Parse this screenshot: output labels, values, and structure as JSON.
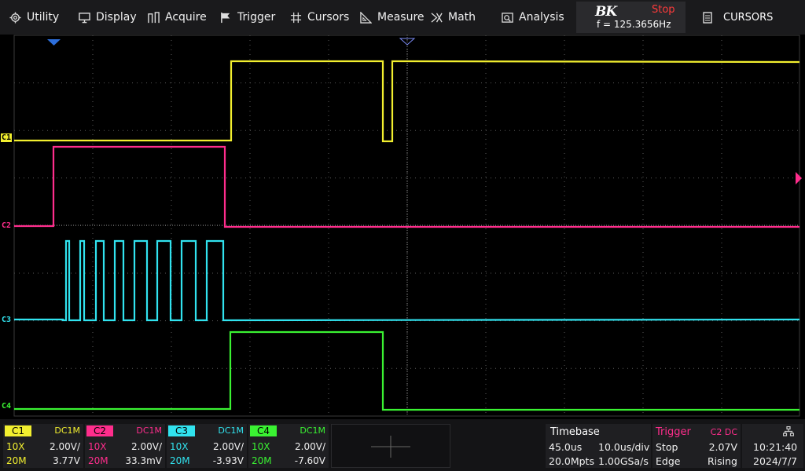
{
  "menu": {
    "items": [
      {
        "label": "Utility",
        "icon": "gear-icon"
      },
      {
        "label": "Display",
        "icon": "monitor-icon"
      },
      {
        "label": "Acquire",
        "icon": "acquire-icon"
      },
      {
        "label": "Trigger",
        "icon": "flag-icon"
      },
      {
        "label": "Cursors",
        "icon": "crosshair-icon"
      },
      {
        "label": "Measure",
        "icon": "ruler-icon"
      },
      {
        "label": "Math",
        "icon": "math-icon"
      },
      {
        "label": "Analysis",
        "icon": "analysis-icon"
      }
    ]
  },
  "brand": {
    "logo": "BK",
    "status": "Stop",
    "frequency": "f = 125.3656Hz"
  },
  "cursors_button": {
    "label": "CURSORS",
    "icon": "document-icon"
  },
  "channels": [
    {
      "id": "C1",
      "color": "#f2ef2f",
      "coupling": "DC1M",
      "probe": "10X",
      "scale": "2.00V/",
      "bandwidth": "20M",
      "offset": "3.77V"
    },
    {
      "id": "C2",
      "color": "#ff2d8c",
      "coupling": "DC1M",
      "probe": "10X",
      "scale": "2.00V/",
      "bandwidth": "20M",
      "offset": "33.3mV"
    },
    {
      "id": "C3",
      "color": "#31e3ef",
      "coupling": "DC1M",
      "probe": "10X",
      "scale": "2.00V/",
      "bandwidth": "20M",
      "offset": "-3.93V"
    },
    {
      "id": "C4",
      "color": "#3af232",
      "coupling": "DC1M",
      "probe": "10X",
      "scale": "2.00V/",
      "bandwidth": "20M",
      "offset": "-7.60V"
    }
  ],
  "timebase": {
    "label": "Timebase",
    "delay": "45.0us",
    "scale": "10.0us/div",
    "memory": "20.0Mpts",
    "sample_rate": "1.00GSa/s"
  },
  "trigger": {
    "label": "Trigger",
    "source": "C2 DC",
    "mode": "Stop",
    "level": "2.07V",
    "type": "Edge",
    "slope": "Rising"
  },
  "clock": {
    "time": "10:21:40",
    "date": "2024/7/7",
    "icon": "network-icon"
  },
  "colors": {
    "menu_bg": "#1a1a1c",
    "grid": "#555555",
    "trigger_marker": "#ff2d8c",
    "timebase_label": "#ffffff",
    "trigger_label": "#ff2d8c"
  }
}
